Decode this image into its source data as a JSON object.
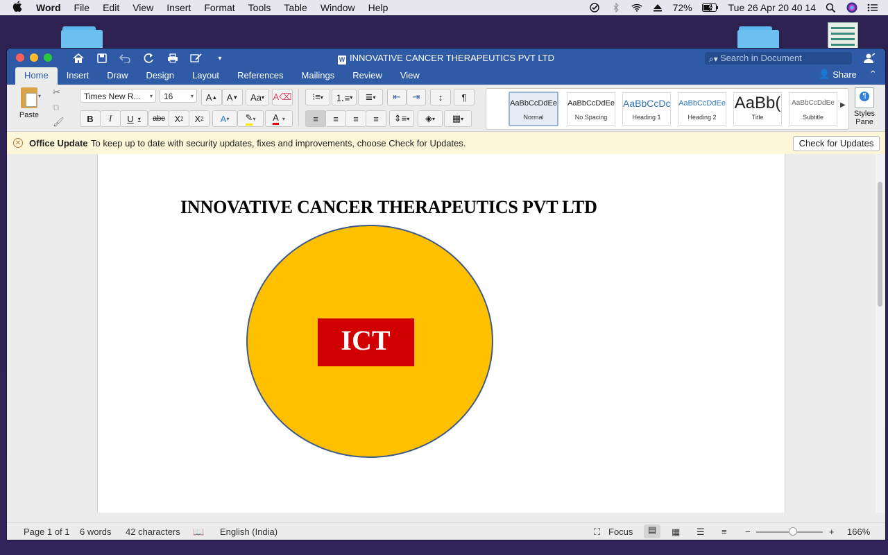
{
  "menubar": {
    "apple": "",
    "app": "Word",
    "items": [
      "File",
      "Edit",
      "View",
      "Insert",
      "Format",
      "Tools",
      "Table",
      "Window",
      "Help"
    ],
    "battery": "72%",
    "datetime": "Tue 26 Apr  20 40 14"
  },
  "window": {
    "title": "INNOVATIVE CANCER THERAPEUTICS PVT LTD",
    "search_placeholder": "Search in Document",
    "share_label": "Share",
    "tabs": [
      "Home",
      "Insert",
      "Draw",
      "Design",
      "Layout",
      "References",
      "Mailings",
      "Review",
      "View"
    ]
  },
  "ribbon": {
    "paste_label": "Paste",
    "font_name": "Times New R...",
    "font_size": "16",
    "styles": [
      {
        "preview": "AaBbCcDdEe",
        "label": "Normal"
      },
      {
        "preview": "AaBbCcDdEe",
        "label": "No Spacing"
      },
      {
        "preview": "AaBbCcDc",
        "label": "Heading 1"
      },
      {
        "preview": "AaBbCcDdEe",
        "label": "Heading 2"
      },
      {
        "preview": "AaBb(",
        "label": "Title"
      },
      {
        "preview": "AaBbCcDdEe",
        "label": "Subtitle"
      }
    ],
    "styles_pane_label": "Styles Pane"
  },
  "update_bar": {
    "title": "Office Update",
    "message": "To keep up to date with security updates, fixes and improvements, choose Check for Updates.",
    "button": "Check for Updates"
  },
  "document": {
    "heading": "INNOVATIVE CANCER THERAPEUTICS PVT LTD",
    "logo_text": "ICT",
    "circle_color": "#FFC000",
    "box_color": "#D00000"
  },
  "statusbar": {
    "page": "Page 1 of 1",
    "words": "6 words",
    "characters": "42 characters",
    "language": "English (India)",
    "focus": "Focus",
    "zoom": "166%",
    "zoom_level": 0.55
  }
}
